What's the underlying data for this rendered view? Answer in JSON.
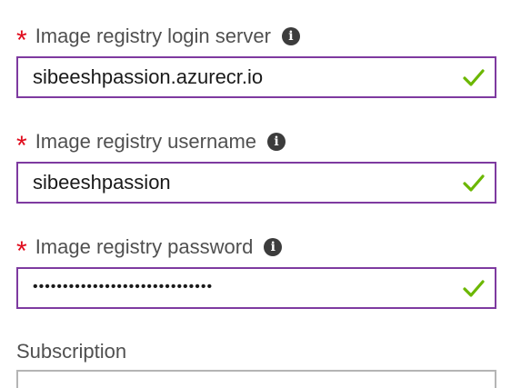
{
  "fields": [
    {
      "label": "Image registry login server",
      "required_mark": "*",
      "info_icon": "info-icon",
      "value": "sibeeshpassion.azurecr.io",
      "valid": true
    },
    {
      "label": "Image registry username",
      "required_mark": "*",
      "info_icon": "info-icon",
      "value": "sibeeshpassion",
      "valid": true
    },
    {
      "label": "Image registry password",
      "required_mark": "*",
      "info_icon": "info-icon",
      "value": "••••••••••••••••••••••••••••••",
      "valid": true
    }
  ],
  "subscription": {
    "label": "Subscription"
  },
  "colors": {
    "required": "#e00b1c",
    "focus_border": "#7e3aa0",
    "valid_check": "#6bb700",
    "label_text": "#505050",
    "info_icon_bg": "#3c3c3c"
  }
}
